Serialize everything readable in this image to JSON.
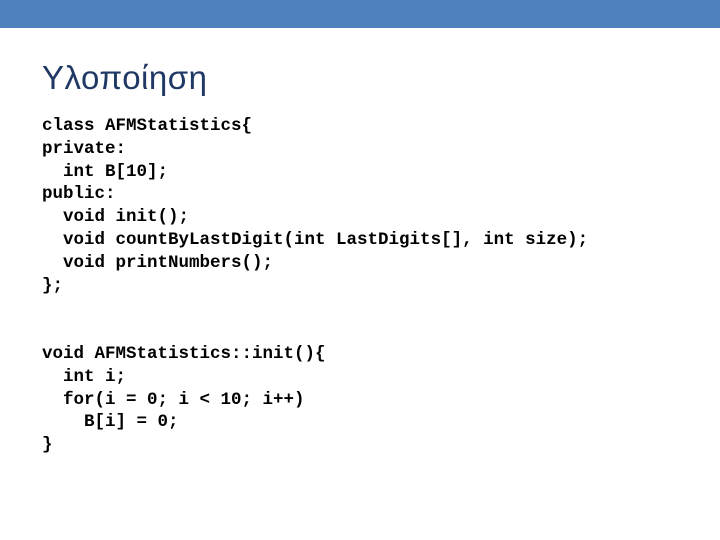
{
  "slide": {
    "title": "Υλοποίηση",
    "accent_color": "#4f81bd",
    "title_color": "#1f3864"
  },
  "code_blocks": [
    {
      "lines": [
        "class AFMStatistics{",
        "private:",
        "  int B[10];",
        "public:",
        "  void init();",
        "  void countByLastDigit(int LastDigits[], int size);",
        "  void printNumbers();",
        "};"
      ]
    },
    {
      "lines": [
        "void AFMStatistics::init(){",
        "  int i;",
        "  for(i = 0; i < 10; i++)",
        "    B[i] = 0;",
        "}"
      ]
    }
  ]
}
